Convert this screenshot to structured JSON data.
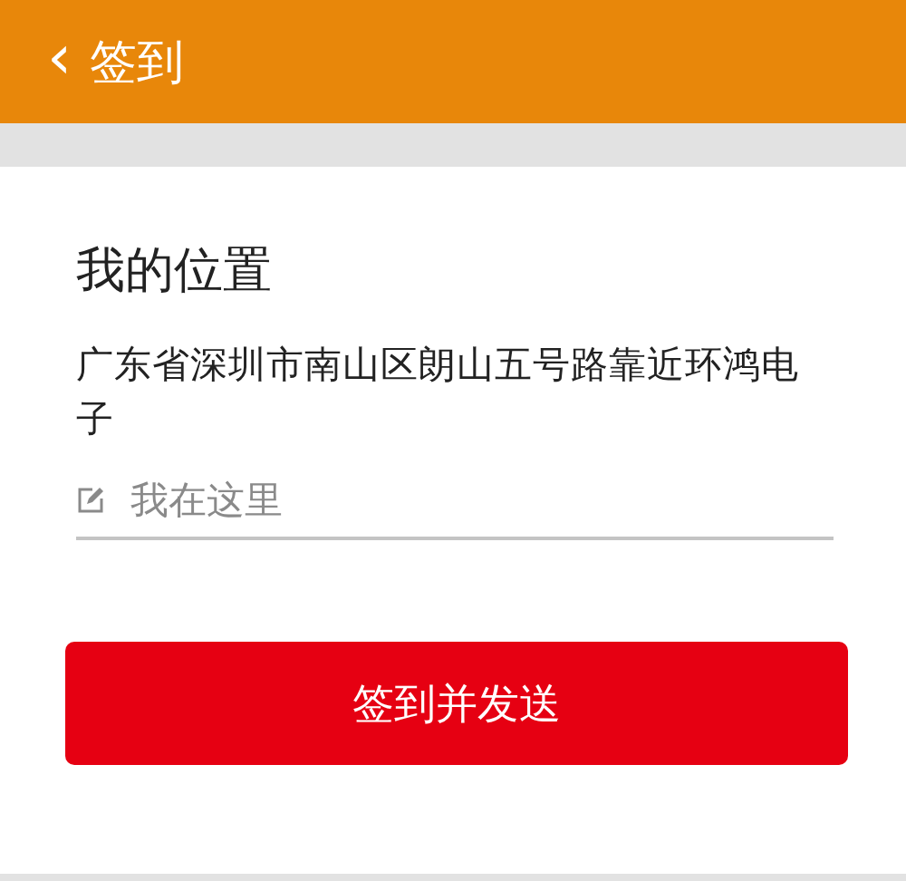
{
  "header": {
    "back_icon": "‹",
    "title": "签到"
  },
  "location": {
    "heading": "我的位置",
    "address": "广东省深圳市南山区朗山五号路靠近环鸿电子"
  },
  "note_field": {
    "placeholder": "我在这里"
  },
  "submit_button": "签到并发送"
}
